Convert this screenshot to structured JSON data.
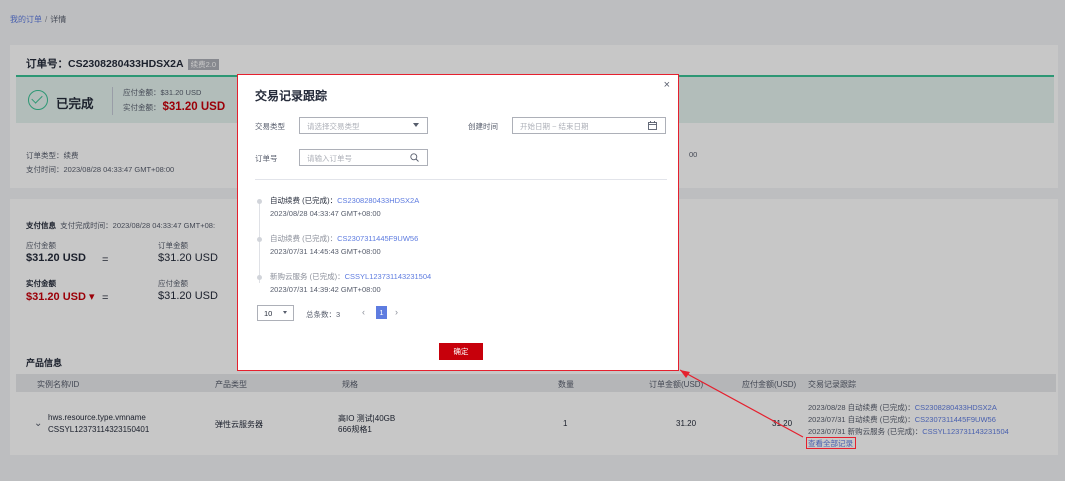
{
  "breadcrumb": {
    "root": "我的订单",
    "separator": "/",
    "current": "详情"
  },
  "order": {
    "title": "订单号：CS2308280433HDSX2A",
    "tag": "续费2.0"
  },
  "status": {
    "text": "已完成",
    "payable": "应付金额：$31.20 USD",
    "paid_label": "实付金额：",
    "paid_value": "$31.20 USD"
  },
  "info": {
    "type": "订单类型：续费",
    "pay_time": "支付时间：2023/08/28 04:33:47 GMT+08:00",
    "partial_time": "00"
  },
  "payment": {
    "title": "支付信息",
    "subtitle": "支付完成时间：2023/08/28 04:33:47 GMT+08:",
    "payable_label": "应付金额",
    "payable_value": "$31.20 USD",
    "eq": "=",
    "order_label": "订单金额",
    "order_value": "$31.20 USD",
    "paid_label": "实付金额",
    "paid_value": "$31.20 USD ▾",
    "order_label2": "应付金额",
    "order_value2": "$31.20 USD"
  },
  "products": {
    "title": "产品信息",
    "headers": [
      "实例名称/ID",
      "产品类型",
      "规格",
      "数量",
      "订单金额(USD)",
      "应付金额(USD)",
      "交易记录跟踪"
    ],
    "row": {
      "name": "hws.resource.type.vmname",
      "id": "CSSYL12373114323150401",
      "type": "弹性云服务器",
      "spec1": "高IO 测试|40GB",
      "spec2": "666规格1",
      "qty": "1",
      "order_amount": "31.20",
      "payable_amount": "31.20",
      "records": [
        {
          "prefix": "2023/08/28 自动续费 (已完成)：",
          "id": "CS2308280433HDSX2A"
        },
        {
          "prefix": "2023/07/31 自动续费 (已完成)：",
          "id": "CS2307311445F9UW56"
        },
        {
          "prefix": "2023/07/31 新购云服务 (已完成)：",
          "id": "CSSYL123731143231504"
        }
      ],
      "view_all": "查看全部记录"
    }
  },
  "modal": {
    "title": "交易记录跟踪",
    "close": "×",
    "type_label": "交易类型",
    "type_placeholder": "请选择交易类型",
    "created_label": "创建时间",
    "date_placeholder": "开始日期 ~ 结束日期",
    "order_label": "订单号",
    "order_placeholder": "请输入订单号",
    "timeline": [
      {
        "type": "自动续费 (已完成)：",
        "id": "CS2308280433HDSX2A",
        "time": "2023/08/28 04:33:47 GMT+08:00"
      },
      {
        "type": "自动续费 (已完成)：",
        "id": "CS2307311445F9UW56",
        "time": "2023/07/31 14:45:43 GMT+08:00"
      },
      {
        "type": "新购云服务 (已完成)：",
        "id": "CSSYL123731143231504",
        "time": "2023/07/31 14:39:42 GMT+08:00"
      }
    ],
    "page_size": "10",
    "total": "总条数：3",
    "prev": "‹",
    "next": "›",
    "page": "1",
    "confirm": "确定"
  },
  "colors": {
    "accent": "#5e7ce0",
    "danger": "#c7000b",
    "success": "#3ac295"
  }
}
